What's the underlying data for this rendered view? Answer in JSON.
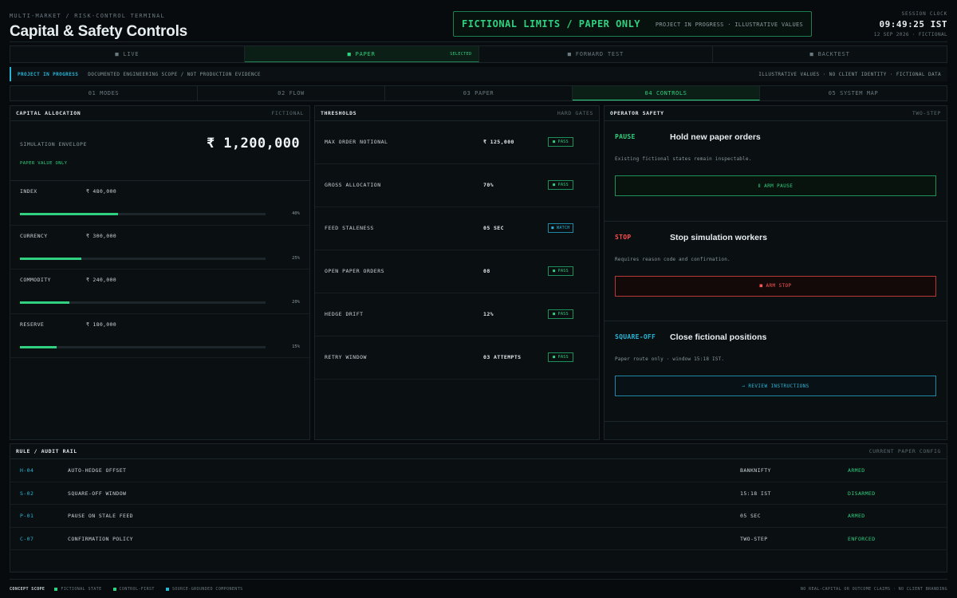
{
  "header": {
    "kicker": "MULTI-MARKET / RISK-CONTROL TERMINAL",
    "title": "Capital & Safety Controls",
    "banner_main": "FICTIONAL LIMITS / PAPER ONLY",
    "banner_sub": "PROJECT IN PROGRESS · ILLUSTRATIVE VALUES",
    "clock_label": "SESSION CLOCK",
    "clock_time": "09:49:25 IST",
    "clock_date": "12 SEP 2026 · FICTIONAL"
  },
  "mode_tabs": [
    {
      "label": "■ LIVE"
    },
    {
      "label": "■ PAPER",
      "tag": "SELECTED"
    },
    {
      "label": "■ FORWARD TEST"
    },
    {
      "label": "■ BACKTEST"
    }
  ],
  "scope": {
    "status": "PROJECT IN PROGRESS",
    "note": "DOCUMENTED ENGINEERING SCOPE / NOT PRODUCTION EVIDENCE",
    "right": "ILLUSTRATIVE VALUES · NO CLIENT IDENTITY · FICTIONAL DATA"
  },
  "section_tabs": [
    {
      "label": "01 MODES"
    },
    {
      "label": "02 FLOW"
    },
    {
      "label": "03 PAPER"
    },
    {
      "label": "04 CONTROLS"
    },
    {
      "label": "05 SYSTEM MAP"
    }
  ],
  "capital": {
    "title": "CAPITAL ALLOCATION",
    "subtitle": "FICTIONAL",
    "envelope_label": "SIMULATION ENVELOPE",
    "envelope_value": "₹ 1,200,000",
    "envelope_note": "PAPER VALUE ONLY",
    "allocations": [
      {
        "name": "INDEX",
        "value": "₹ 480,000",
        "pct_label": "40%",
        "fraction": 0.4
      },
      {
        "name": "CURRENCY",
        "value": "₹ 300,000",
        "pct_label": "25%",
        "fraction": 0.25
      },
      {
        "name": "COMMODITY",
        "value": "₹ 240,000",
        "pct_label": "20%",
        "fraction": 0.2
      },
      {
        "name": "RESERVE",
        "value": "₹ 180,000",
        "pct_label": "15%",
        "fraction": 0.15
      }
    ]
  },
  "thresholds": {
    "title": "THRESHOLDS",
    "subtitle": "HARD GATES",
    "rows": [
      {
        "name": "MAX ORDER NOTIONAL",
        "value": "₹ 125,000",
        "status": "■ PASS"
      },
      {
        "name": "GROSS ALLOCATION",
        "value": "70%",
        "status": "■ PASS"
      },
      {
        "name": "FEED STALENESS",
        "value": "05 SEC",
        "status": "■ WATCH"
      },
      {
        "name": "OPEN PAPER ORDERS",
        "value": "08",
        "status": "■ PASS"
      },
      {
        "name": "HEDGE DRIFT",
        "value": "12%",
        "status": "■ PASS"
      },
      {
        "name": "RETRY WINDOW",
        "value": "03 ATTEMPTS",
        "status": "■ PASS"
      }
    ]
  },
  "safety": {
    "title": "OPERATOR SAFETY",
    "subtitle": "TWO-STEP",
    "pause": {
      "key": "PAUSE",
      "title": "Hold new paper orders",
      "desc": "Existing fictional states remain inspectable.",
      "button": "Ⅱ ARM PAUSE"
    },
    "stop": {
      "key": "STOP",
      "title": "Stop simulation workers",
      "desc": "Requires reason code and confirmation.",
      "button": "■ ARM STOP"
    },
    "squareoff": {
      "key": "SQUARE-OFF",
      "title": "Close fictional positions",
      "desc": "Paper route only · window 15:18 IST.",
      "button": "→ REVIEW INSTRUCTIONS"
    }
  },
  "rail": {
    "title": "RULE / AUDIT RAIL",
    "subtitle": "CURRENT PAPER CONFIG",
    "rows": [
      {
        "id": "H-04",
        "name": "AUTO-HEDGE OFFSET",
        "value": "BANKNIFTY",
        "state": "ARMED"
      },
      {
        "id": "S-02",
        "name": "SQUARE-OFF WINDOW",
        "value": "15:18 IST",
        "state": "DISARMED"
      },
      {
        "id": "P-01",
        "name": "PAUSE ON STALE FEED",
        "value": "05 SEC",
        "state": "ARMED"
      },
      {
        "id": "C-07",
        "name": "CONFIRMATION POLICY",
        "value": "TWO-STEP",
        "state": "ENFORCED"
      }
    ]
  },
  "footer": {
    "left": "CONCEPT SCOPE",
    "legend": [
      "FICTIONAL STATE",
      "CONTROL-FIRST",
      "SOURCE-GROUNDED COMPONENTS"
    ],
    "right": "NO REAL-CAPITAL OR OUTCOME CLAIMS · NO CLIENT BRANDING"
  },
  "colors": {
    "accent_green": "#2fd07f",
    "accent_cyan": "#27b6d6",
    "danger_red": "#ff4d4d",
    "background": "#070b0e"
  }
}
